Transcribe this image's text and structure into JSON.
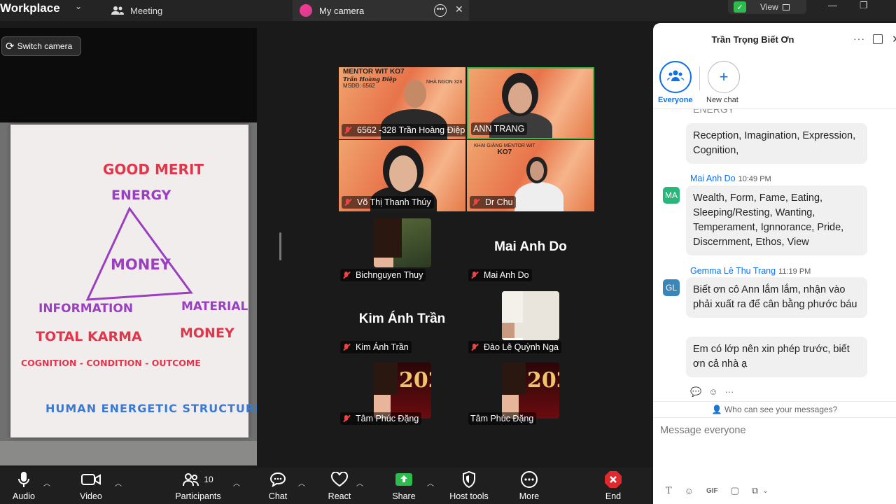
{
  "app": {
    "title": "Workplace"
  },
  "tabs": {
    "meeting": "Meeting",
    "camera": "My camera"
  },
  "view_label": "View",
  "switch_camera": "Switch camera",
  "whiteboard": {
    "good_merit": "GOOD MERIT",
    "energy": "ENERGY",
    "money_center": "MONEY",
    "information": "INFORMATION",
    "material": "MATERIAL",
    "total_karma": "TOTAL KARMA",
    "money": "MONEY",
    "cognition": "COGNITION - CONDITION - OUTCOME",
    "human": "HUMAN ENERGETIC STRUCTURE"
  },
  "gallery": {
    "video": [
      {
        "name": "6562 -328 Trần Hoàng Điệp",
        "badge1": "MENTOR WIT KO7",
        "badge2": "Trần Hoàng Điệp",
        "badge3": "MSĐĐ: 6562",
        "badge4": "NHÀ NGON 328"
      },
      {
        "name": "ANN TRANG"
      },
      {
        "name": "Võ Thị Thanh Thúy"
      },
      {
        "name": "Dr Chu",
        "badge1": "KHAI GIẢNG MENTOR WIT",
        "badge2": "KO7"
      }
    ],
    "others": [
      {
        "name": "Bichnguyen Thuy"
      },
      {
        "name": "Mai Anh Do",
        "display": "Mai Anh Do"
      },
      {
        "name": "Kim Ánh Trần",
        "display": "Kim Ánh Trần"
      },
      {
        "name": "Đào Lê Quỳnh Nga"
      },
      {
        "name": "Tâm Phúc Đặng",
        "badge": "202"
      },
      {
        "name": "Tâm Phúc Đặng",
        "badge": "202"
      }
    ]
  },
  "toolbar": {
    "audio": "Audio",
    "video": "Video",
    "participants": "Participants",
    "participants_count": "10",
    "chat": "Chat",
    "react": "React",
    "share": "Share",
    "host_tools": "Host tools",
    "more": "More",
    "end": "End"
  },
  "chat": {
    "title": "Trần Trọng Biết Ơn",
    "everyone_label": "Everyone",
    "new_chat_label": "New chat",
    "partial_top": "ENERGY",
    "messages": [
      {
        "text": "Reception, Imagination, Expression, Cognition,"
      },
      {
        "sender": "Mai Anh Do",
        "time": "10:49 PM",
        "initials": "MA",
        "text": "Wealth, Form, Fame, Eating, Sleeping/Resting, Wanting, Temperament, Ignnorance, Pride, Discernment, Ethos, View"
      },
      {
        "sender": "Gemma Lê Thu Trang",
        "time": "11:19 PM",
        "initials": "GL",
        "text": "Biết ơn cô Ann lắm lắm, nhận vào phải xuất ra để cân bằng phước báu"
      },
      {
        "text": "Em có lớp nên xin phép trước, biết ơn cả nhà ạ"
      }
    ],
    "who_can_see": "Who can see your messages?",
    "input_placeholder": "Message everyone",
    "gif_label": "GIF"
  },
  "colors": {
    "accent": "#0e71eb",
    "share": "#2dbb4e",
    "end": "#e0282e",
    "mute": "#e44444"
  }
}
